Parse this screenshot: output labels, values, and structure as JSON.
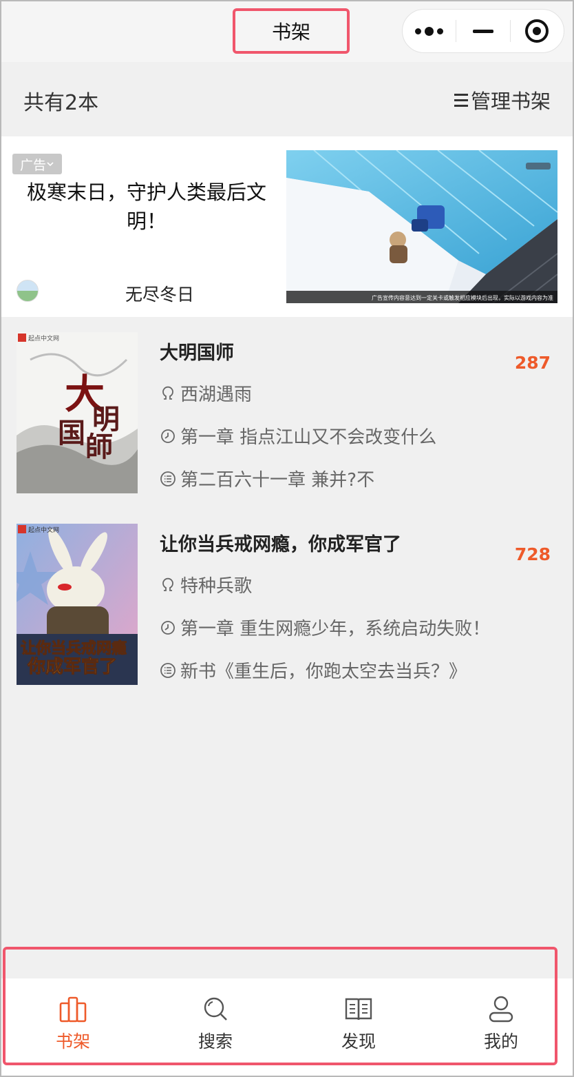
{
  "nav": {
    "title": "书架"
  },
  "shelf": {
    "count_text": "共有2本",
    "manage_label": "管理书架"
  },
  "ad": {
    "tag": "广告",
    "title": "极寒末日，守护人类最后文明！",
    "source": "无尽冬日",
    "image_caption": "广告宣传内容意达到一定关卡或触发相应模块后出现，实际以游戏内容为准"
  },
  "books": [
    {
      "title": "大明国师",
      "author": "西湖遇雨",
      "last_read": "第一章 指点江山又不会改变什么",
      "latest": "第二百六十一章 兼并?不",
      "badge": "287",
      "cover_title": "大明国師",
      "cover_publisher": "起点中文网"
    },
    {
      "title": "让你当兵戒网瘾，你成军官了",
      "author": "特种兵歌",
      "last_read": "第一章 重生网瘾少年，系统启动失败！",
      "latest": "新书《重生后，你跑太空去当兵？》",
      "badge": "728",
      "cover_title": "让你当兵戒网瘾 你成军官了",
      "cover_publisher": "起点中文网"
    }
  ],
  "tabbar": {
    "items": [
      {
        "label": "书架",
        "icon": "bookshelf-icon",
        "active": true
      },
      {
        "label": "搜索",
        "icon": "search-icon",
        "active": false
      },
      {
        "label": "发现",
        "icon": "book-open-icon",
        "active": false
      },
      {
        "label": "我的",
        "icon": "user-icon",
        "active": false
      }
    ]
  },
  "colors": {
    "accent": "#ee5a2a",
    "highlight": "#f0566c"
  }
}
